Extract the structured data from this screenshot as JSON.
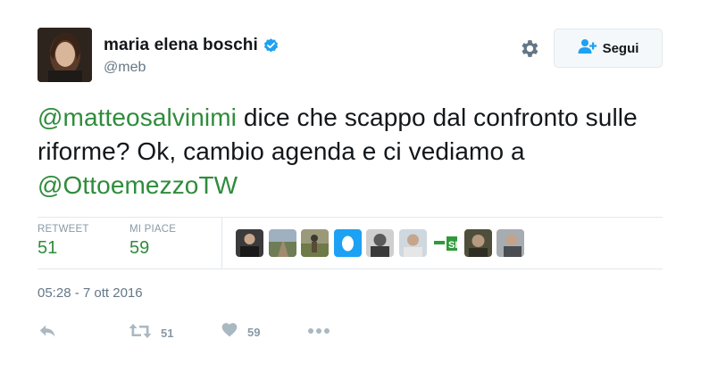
{
  "user": {
    "display_name": "maria elena boschi",
    "handle": "@meb",
    "verified": true
  },
  "follow_button": {
    "label": "Segui"
  },
  "tweet": {
    "mention1": "@matteosalvinimi",
    "text_part1": " dice che scappo dal confronto sulle riforme? Ok, cambio agenda e ci vediamo a ",
    "mention2": "@OttoemezzoTW"
  },
  "stats": {
    "retweet_label": "RETWEET",
    "retweet_count": "51",
    "likes_label": "MI PIACE",
    "likes_count": "59"
  },
  "likers": [
    {
      "name": "liker-avatar-1",
      "color": "#2b2b2b"
    },
    {
      "name": "liker-avatar-2",
      "color": "#7b8a6a"
    },
    {
      "name": "liker-avatar-3",
      "color": "#8a7a5c"
    },
    {
      "name": "liker-avatar-4-default-egg",
      "color": "#1da1f2"
    },
    {
      "name": "liker-avatar-5",
      "color": "#555555"
    },
    {
      "name": "liker-avatar-6",
      "color": "#b8a89a"
    },
    {
      "name": "liker-avatar-7-si",
      "color": "#2f9a3a"
    },
    {
      "name": "liker-avatar-8",
      "color": "#6b6b55"
    },
    {
      "name": "liker-avatar-9",
      "color": "#8a8e92"
    }
  ],
  "timestamp": "05:28 - 7 ott 2016",
  "actions": {
    "retweet_count": "51",
    "like_count": "59"
  },
  "colors": {
    "mention": "#2f8c3c",
    "icon_gray": "#aab8c2",
    "verified_blue": "#1da1f2"
  }
}
